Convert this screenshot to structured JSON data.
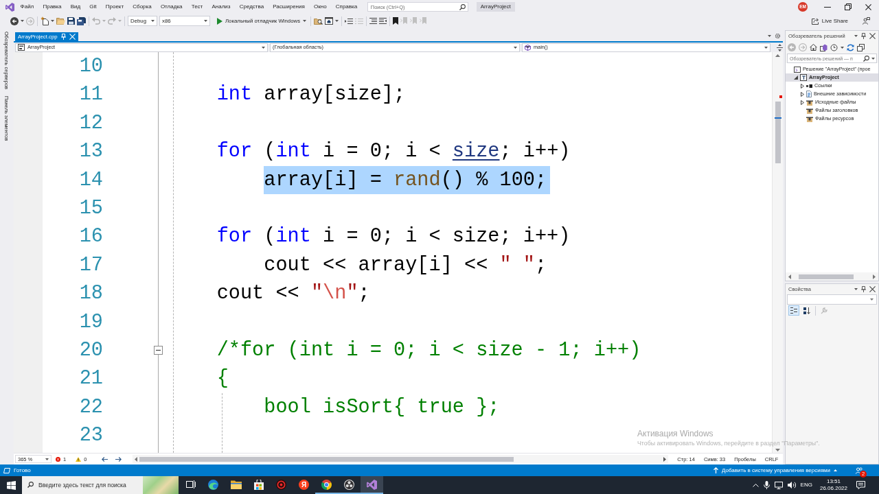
{
  "title_bar": {
    "menu": [
      "Файл",
      "Правка",
      "Вид",
      "Git",
      "Проект",
      "Сборка",
      "Отладка",
      "Тест",
      "Анализ",
      "Средства",
      "Расширения",
      "Окно",
      "Справка"
    ],
    "search": {
      "placeholder": "Поиск (Ctrl+Q)"
    },
    "solution_name": "ArrayProject",
    "account_initials": "EM"
  },
  "toolbar": {
    "configuration": "Debug",
    "platform": "x86",
    "run_target": "Локальный отладчик Windows",
    "live_share": "Live Share"
  },
  "side_tabs": [
    "Обозреватель серверов",
    "Панель элементов"
  ],
  "document_tabs": [
    {
      "label": "ArrayProject.cpp",
      "selected": true
    }
  ],
  "navigation_bar": {
    "project": "ArrayProject",
    "scope": "(Глобальная область)",
    "member": "main()"
  },
  "editor": {
    "lines": [
      {
        "number": "10",
        "selected": false,
        "collapsible": false
      },
      {
        "number": "11",
        "selected": false,
        "collapsible": false,
        "tokens": [
          {
            "kind": "keyword",
            "text": "    int"
          },
          {
            "kind": "plain",
            "text": " array[size];"
          }
        ]
      },
      {
        "number": "12",
        "selected": false,
        "collapsible": false
      },
      {
        "number": "13",
        "selected": false,
        "collapsible": false,
        "tokens": [
          {
            "kind": "keyword",
            "text": "    for"
          },
          {
            "kind": "plain",
            "text": " ("
          },
          {
            "kind": "keyword",
            "text": "int"
          },
          {
            "kind": "plain",
            "text": " i = 0; i < "
          },
          {
            "kind": "link",
            "text": "size"
          },
          {
            "kind": "plain",
            "text": "; i++)"
          }
        ]
      },
      {
        "number": "14",
        "selected": true,
        "collapsible": false,
        "tokens": [
          {
            "kind": "plain",
            "text": "        array[i] = "
          },
          {
            "kind": "function",
            "text": "rand"
          },
          {
            "kind": "plain",
            "text": "() % 100;"
          }
        ]
      },
      {
        "number": "15",
        "selected": false,
        "collapsible": false
      },
      {
        "number": "16",
        "selected": false,
        "collapsible": false,
        "tokens": [
          {
            "kind": "keyword",
            "text": "    for"
          },
          {
            "kind": "plain",
            "text": " ("
          },
          {
            "kind": "keyword",
            "text": "int"
          },
          {
            "kind": "plain",
            "text": " i = 0; i < size; i++)"
          }
        ]
      },
      {
        "number": "17",
        "selected": false,
        "collapsible": false,
        "tokens": [
          {
            "kind": "plain",
            "text": "        cout << array[i] << "
          },
          {
            "kind": "string",
            "text": "\" \""
          },
          {
            "kind": "plain",
            "text": ";"
          }
        ]
      },
      {
        "number": "18",
        "selected": false,
        "collapsible": false,
        "tokens": [
          {
            "kind": "plain",
            "text": "    cout << "
          },
          {
            "kind": "string",
            "text": "\""
          },
          {
            "kind": "escape",
            "text": "\\n"
          },
          {
            "kind": "string",
            "text": "\""
          },
          {
            "kind": "plain",
            "text": ";"
          }
        ]
      },
      {
        "number": "19",
        "selected": false,
        "collapsible": false
      },
      {
        "number": "20",
        "selected": false,
        "collapsible": true,
        "tokens": [
          {
            "kind": "comment",
            "text": "    /*for (int i = 0; i < size - 1; i++)"
          }
        ]
      },
      {
        "number": "21",
        "selected": false,
        "collapsible": false,
        "tokens": [
          {
            "kind": "comment",
            "text": "    {"
          }
        ]
      },
      {
        "number": "22",
        "selected": false,
        "collapsible": false,
        "tokens": [
          {
            "kind": "comment",
            "text": "        bool isSort{ true };"
          }
        ]
      },
      {
        "number": "23",
        "selected": false,
        "collapsible": false
      }
    ],
    "zoom": "365 %",
    "errors": "1",
    "warnings": "0",
    "line_position": "Стр: 14",
    "column_position": "Симв: 33",
    "indentation": "Пробелы",
    "line_endings": "CRLF"
  },
  "windows_activation": {
    "title": "Активация Windows",
    "message": "Чтобы активировать Windows, перейдите в раздел \"Параметры\"."
  },
  "solution_explorer": {
    "title": "Обозреватель решений",
    "search": {
      "placeholder": "Обозреватель решений — п"
    },
    "tree": [
      {
        "kind": "solution",
        "label": "Решение \"ArrayProject\" (прое",
        "selected": false,
        "children": [
          {
            "kind": "project",
            "label": "ArrayProject",
            "expanded": true,
            "selected": true,
            "children": [
              {
                "kind": "references",
                "label": "Ссылки",
                "expanded": false,
                "selected": false
              },
              {
                "kind": "dependencies",
                "label": "Внешние зависимости",
                "expanded": false,
                "selected": false
              },
              {
                "kind": "filter",
                "label": "Исходные файлы",
                "expanded": false,
                "selected": false
              },
              {
                "kind": "filter",
                "label": "Файлы заголовков",
                "selected": false
              },
              {
                "kind": "filter",
                "label": "Файлы ресурсов",
                "selected": false
              }
            ]
          }
        ]
      }
    ]
  },
  "properties": {
    "title": "Свойства"
  },
  "status_bar": {
    "text": "Готово",
    "source_control": "Добавить в систему управления версиями",
    "notification_count": "2"
  },
  "taskbar": {
    "search": {
      "placeholder": "Введите здесь текст для поиска"
    },
    "apps": [
      {
        "kind": "task_view",
        "running": false,
        "selected": false
      },
      {
        "kind": "browser_wave",
        "running": false,
        "selected": false
      },
      {
        "kind": "folder",
        "running": false,
        "selected": false
      },
      {
        "kind": "store",
        "running": false,
        "selected": false
      },
      {
        "kind": "record",
        "running": false,
        "selected": false
      },
      {
        "kind": "letter",
        "label": "Я",
        "running": false,
        "selected": false
      },
      {
        "kind": "browser_ball",
        "running": true,
        "selected": false
      },
      {
        "kind": "camera",
        "running": true,
        "selected": false
      },
      {
        "kind": "ide",
        "running": true,
        "selected": true
      }
    ],
    "language": "ENG",
    "time": "13:51",
    "date": "26.06.2022"
  }
}
